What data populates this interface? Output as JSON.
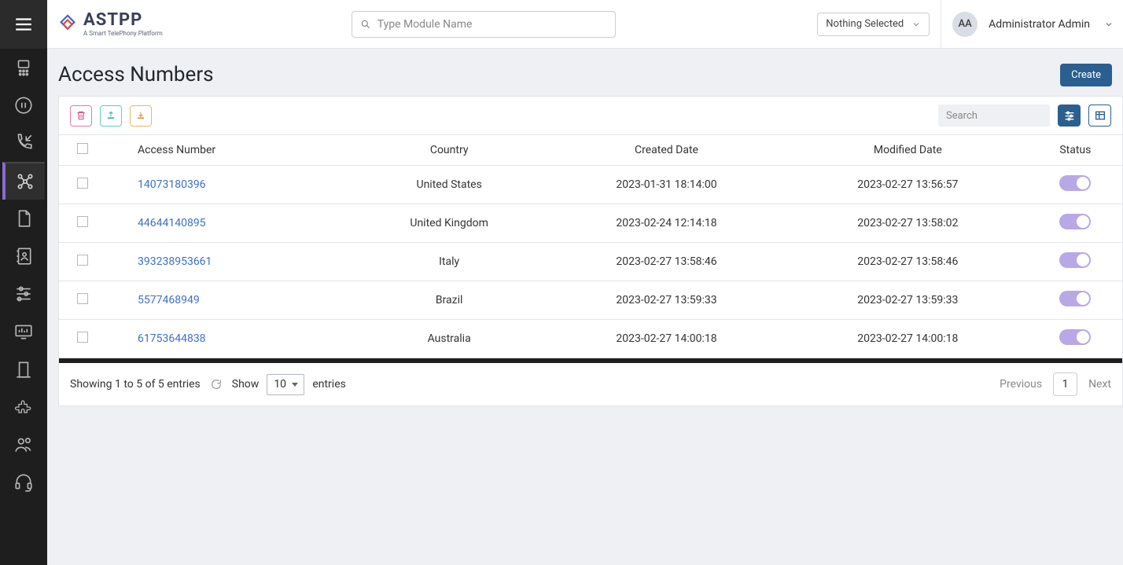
{
  "brand": {
    "name": "ASTPP",
    "tagline": "A Smart TelePhony Platform"
  },
  "search": {
    "placeholder": "Type Module Name"
  },
  "header": {
    "select_label": "Nothing Selected",
    "avatar_initials": "AA",
    "user_name": "Administrator Admin"
  },
  "page": {
    "title": "Access Numbers",
    "create_label": "Create"
  },
  "toolbar": {
    "search_placeholder": "Search"
  },
  "table": {
    "columns": [
      "Access Number",
      "Country",
      "Created Date",
      "Modified Date",
      "Status"
    ],
    "rows": [
      {
        "number": "14073180396",
        "country": "United States",
        "created": "2023-01-31 18:14:00",
        "modified": "2023-02-27 13:56:57",
        "active": true
      },
      {
        "number": "44644140895",
        "country": "United Kingdom",
        "created": "2023-02-24 12:14:18",
        "modified": "2023-02-27 13:58:02",
        "active": true
      },
      {
        "number": "393238953661",
        "country": "Italy",
        "created": "2023-02-27 13:58:46",
        "modified": "2023-02-27 13:58:46",
        "active": true
      },
      {
        "number": "5577468949",
        "country": "Brazil",
        "created": "2023-02-27 13:59:33",
        "modified": "2023-02-27 13:59:33",
        "active": true
      },
      {
        "number": "61753644838",
        "country": "Australia",
        "created": "2023-02-27 14:00:18",
        "modified": "2023-02-27 14:00:18",
        "active": true
      }
    ]
  },
  "footer": {
    "info": "Showing 1 to 5 of 5 entries",
    "show_label": "Show",
    "entries_label": "entries",
    "page_size": "10",
    "prev": "Previous",
    "next": "Next",
    "current_page": "1"
  }
}
